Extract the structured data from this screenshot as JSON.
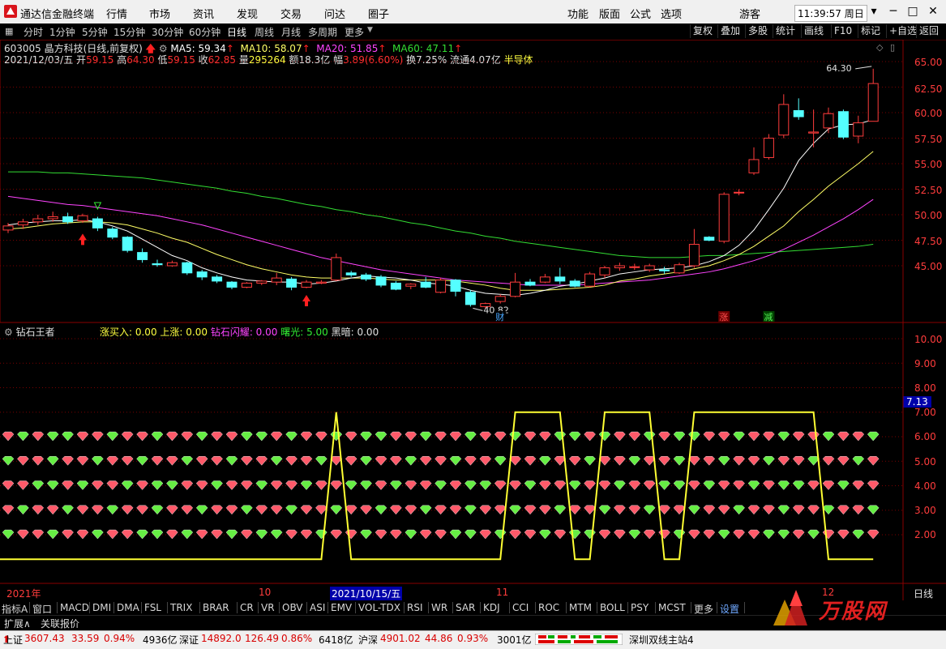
{
  "app": {
    "title": "通达信金融终端",
    "menus": [
      "行情",
      "市场",
      "资讯",
      "发现",
      "交易",
      "问达",
      "圈子"
    ],
    "right_menus": [
      "功能",
      "版面",
      "公式",
      "选项"
    ],
    "user": "游客",
    "clock": "11:39:57 周日"
  },
  "toolbar": {
    "periods": [
      "分时",
      "1分钟",
      "5分钟",
      "15分钟",
      "30分钟",
      "60分钟",
      "日线",
      "周线",
      "月线",
      "多周期",
      "更多"
    ],
    "active_period": "日线",
    "right_buttons": [
      "复权",
      "叠加",
      "多股",
      "统计",
      "画线",
      "F10",
      "标记",
      "+自选",
      "返回"
    ]
  },
  "stock": {
    "code_name": "603005 晶方科技(日线,前复权)",
    "date": "2021/12/03/五",
    "open_label": "开",
    "open": "59.15",
    "high_label": "高",
    "high": "64.30",
    "low_label": "低",
    "low": "59.15",
    "close_label": "收",
    "close": "62.85",
    "volume_label": "量",
    "volume": "295264",
    "amount_label": "额",
    "amount": "18.3亿",
    "change_label": "幅",
    "change": "3.89(6.60%)",
    "turnover": "换7.25%",
    "float_cap": "流通4.07亿",
    "sector": "半导体",
    "high_annotation": "64.30",
    "low_annotation": "40.82",
    "marker_cai": "财",
    "marker_zhang": "涨",
    "marker_jian": "减"
  },
  "ma": {
    "ma5": "MA5: 59.34",
    "ma10": "MA10: 58.07",
    "ma20": "MA20: 51.85",
    "ma60": "MA60: 47.11",
    "colors": {
      "ma5": "#ffffff",
      "ma10": "#ffff66",
      "ma20": "#ff44ff",
      "ma60": "#33dd33"
    }
  },
  "indicator": {
    "name": "钻石王者",
    "zhangmairu": "涨买入: 0.00",
    "shangzhang": "上涨: 0.00",
    "zuanshi": "钻石闪耀: 0.00",
    "shuguang": "曙光: 5.00",
    "heian": "黑暗: 0.00",
    "current_value": "7.13"
  },
  "price_axis": [
    "65.00",
    "62.50",
    "60.00",
    "57.50",
    "55.00",
    "52.50",
    "50.00",
    "47.50",
    "45.00"
  ],
  "ind_axis": [
    "10.00",
    "9.00",
    "8.00",
    "7.00",
    "6.00",
    "5.00",
    "4.00",
    "3.00",
    "2.00"
  ],
  "time_axis": {
    "year": "2021年",
    "oct": "10",
    "cursor_date": "2021/10/15/五",
    "nov": "11",
    "dec": "12",
    "period": "日线"
  },
  "indicator_tabs": [
    "指标A",
    "窗口",
    "MACD",
    "DMI",
    "DMA",
    "FSL",
    "TRIX",
    "BRAR",
    "CR",
    "VR",
    "OBV",
    "ASI",
    "EMV",
    "VOL-TDX",
    "RSI",
    "WR",
    "SAR",
    "KDJ",
    "CCI",
    "ROC",
    "MTM",
    "BOLL",
    "PSY",
    "MCST",
    "更多",
    "设置"
  ],
  "bottom": {
    "expand": "扩展∧",
    "related": "关联报价",
    "watermark": "万股网"
  },
  "status": {
    "sh_label": "上证",
    "sh_index": "3607.43",
    "sh_chg": "33.59",
    "sh_pct": "0.94%",
    "sh_amt": "4936亿",
    "sz_label": "深证",
    "sz_index": "14892.0",
    "sz_chg": "126.49",
    "sz_pct": "0.86%",
    "sz_amt": "6418亿",
    "hs_label": "沪深",
    "hs_index": "4901.02",
    "hs_chg": "44.86",
    "hs_pct": "0.93%",
    "hs_amt": "3001亿",
    "server": "深圳双线主站4"
  },
  "chart_data": {
    "type": "candlestick",
    "price_ylim": [
      43,
      66
    ],
    "candles": [
      [
        48.5,
        49.2,
        48.2,
        48.9
      ],
      [
        49.0,
        49.6,
        48.6,
        49.3
      ],
      [
        49.3,
        50.0,
        49.0,
        49.6
      ],
      [
        49.6,
        50.3,
        49.3,
        49.8
      ],
      [
        49.8,
        50.2,
        49.1,
        49.3
      ],
      [
        49.4,
        50.1,
        49.2,
        49.9
      ],
      [
        49.6,
        49.8,
        48.4,
        48.7
      ],
      [
        48.6,
        48.8,
        47.6,
        47.8
      ],
      [
        47.8,
        47.9,
        46.3,
        46.5
      ],
      [
        46.3,
        46.7,
        45.3,
        45.6
      ],
      [
        45.2,
        45.6,
        44.9,
        45.1
      ],
      [
        45.0,
        45.5,
        44.9,
        45.3
      ],
      [
        45.3,
        45.4,
        44.1,
        44.3
      ],
      [
        44.4,
        44.6,
        43.6,
        43.9
      ],
      [
        43.9,
        44.1,
        43.3,
        43.5
      ],
      [
        43.4,
        43.5,
        42.7,
        42.9
      ],
      [
        42.9,
        43.4,
        42.8,
        43.3
      ],
      [
        43.3,
        43.6,
        43.1,
        43.5
      ],
      [
        43.4,
        44.3,
        43.1,
        43.8
      ],
      [
        43.7,
        43.9,
        42.6,
        42.9
      ],
      [
        42.9,
        43.6,
        42.8,
        43.4
      ],
      [
        43.3,
        43.6,
        43.2,
        43.4
      ],
      [
        43.6,
        46.2,
        43.5,
        45.8
      ],
      [
        44.3,
        44.5,
        43.9,
        44.1
      ],
      [
        44.1,
        44.3,
        43.5,
        43.7
      ],
      [
        43.9,
        44.1,
        42.9,
        43.1
      ],
      [
        43.3,
        43.5,
        42.6,
        42.7
      ],
      [
        43.0,
        43.3,
        42.7,
        43.2
      ],
      [
        43.4,
        43.9,
        42.8,
        42.9
      ],
      [
        42.4,
        43.8,
        42.3,
        43.6
      ],
      [
        43.6,
        43.7,
        42.0,
        42.5
      ],
      [
        42.4,
        42.6,
        41.0,
        41.2
      ],
      [
        41.0,
        41.4,
        40.8,
        41.3
      ],
      [
        41.5,
        42.2,
        41.3,
        42.0
      ],
      [
        42.0,
        44.3,
        41.9,
        43.4
      ],
      [
        43.4,
        43.7,
        43.0,
        43.1
      ],
      [
        43.4,
        44.2,
        43.3,
        43.9
      ],
      [
        43.9,
        44.8,
        43.2,
        43.5
      ],
      [
        43.5,
        43.7,
        42.9,
        43.0
      ],
      [
        43.0,
        44.4,
        42.9,
        44.2
      ],
      [
        44.1,
        45.0,
        43.8,
        44.8
      ],
      [
        44.8,
        45.3,
        44.5,
        45.0
      ],
      [
        44.9,
        45.2,
        44.6,
        44.9
      ],
      [
        44.6,
        45.2,
        44.4,
        45.0
      ],
      [
        44.6,
        44.9,
        44.2,
        44.5
      ],
      [
        44.3,
        45.3,
        44.2,
        45.1
      ],
      [
        45.0,
        48.6,
        44.8,
        47.1
      ],
      [
        47.8,
        47.9,
        47.4,
        47.5
      ],
      [
        47.4,
        52.2,
        47.2,
        52.0
      ],
      [
        52.2,
        52.5,
        51.9,
        52.2
      ],
      [
        54.1,
        56.6,
        53.9,
        55.4
      ],
      [
        55.6,
        57.9,
        55.4,
        57.5
      ],
      [
        57.8,
        61.8,
        57.5,
        60.8
      ],
      [
        60.2,
        61.4,
        59.3,
        59.6
      ],
      [
        58.0,
        60.3,
        56.6,
        58.1
      ],
      [
        58.5,
        60.5,
        58.0,
        59.9
      ],
      [
        60.1,
        60.3,
        57.4,
        57.6
      ],
      [
        57.7,
        59.7,
        57.0,
        59.0
      ],
      [
        59.15,
        64.3,
        59.15,
        62.85
      ]
    ],
    "ma5": [
      49.0,
      49.2,
      49.3,
      49.4,
      49.4,
      49.5,
      49.3,
      48.9,
      48.4,
      47.6,
      46.8,
      46.0,
      45.5,
      44.8,
      44.3,
      43.9,
      43.6,
      43.5,
      43.4,
      43.4,
      43.2,
      43.3,
      43.5,
      43.8,
      44.0,
      43.9,
      43.8,
      43.6,
      43.3,
      43.2,
      43.0,
      42.6,
      42.3,
      42.2,
      42.1,
      42.3,
      42.6,
      43.0,
      43.2,
      43.5,
      43.8,
      44.2,
      44.4,
      44.6,
      44.7,
      44.8,
      45.0,
      45.4,
      46.0,
      47.0,
      48.5,
      50.5,
      52.6,
      55.3,
      57.0,
      58.4,
      58.8,
      58.9,
      59.3
    ],
    "ma10": [
      48.6,
      48.7,
      48.9,
      49.1,
      49.2,
      49.3,
      49.3,
      49.2,
      49.0,
      48.6,
      48.2,
      47.7,
      47.3,
      46.7,
      46.1,
      45.6,
      45.1,
      44.7,
      44.4,
      44.1,
      43.9,
      43.8,
      43.8,
      43.8,
      43.8,
      43.7,
      43.6,
      43.6,
      43.6,
      43.6,
      43.5,
      43.3,
      43.1,
      42.8,
      42.6,
      42.6,
      42.6,
      42.7,
      42.8,
      42.9,
      43.1,
      43.5,
      43.7,
      44.0,
      44.2,
      44.4,
      44.7,
      45.0,
      45.5,
      46.1,
      46.9,
      47.9,
      48.9,
      50.3,
      51.5,
      52.8,
      53.9,
      55.0,
      56.2
    ],
    "ma20": [
      51.8,
      51.6,
      51.4,
      51.2,
      51.0,
      50.9,
      50.7,
      50.5,
      50.3,
      50.1,
      49.9,
      49.6,
      49.3,
      49.0,
      48.6,
      48.2,
      47.8,
      47.4,
      47.0,
      46.6,
      46.2,
      45.8,
      45.5,
      45.2,
      44.9,
      44.6,
      44.4,
      44.2,
      44.0,
      43.8,
      43.6,
      43.5,
      43.4,
      43.3,
      43.2,
      43.1,
      43.1,
      43.1,
      43.1,
      43.2,
      43.3,
      43.4,
      43.5,
      43.6,
      43.8,
      44.0,
      44.2,
      44.4,
      44.7,
      45.1,
      45.5,
      46.0,
      46.6,
      47.3,
      48.0,
      48.8,
      49.6,
      50.5,
      51.5
    ],
    "ma60": [
      54.2,
      54.2,
      54.2,
      54.1,
      54.1,
      54.0,
      53.9,
      53.8,
      53.7,
      53.6,
      53.4,
      53.2,
      53.0,
      52.8,
      52.6,
      52.3,
      52.1,
      51.8,
      51.6,
      51.3,
      51.0,
      50.8,
      50.5,
      50.3,
      50.0,
      49.8,
      49.5,
      49.2,
      49.0,
      48.7,
      48.4,
      48.2,
      47.9,
      47.7,
      47.4,
      47.2,
      47.0,
      46.8,
      46.6,
      46.4,
      46.2,
      46.0,
      45.9,
      45.8,
      45.8,
      45.8,
      45.9,
      46.0,
      46.0,
      46.1,
      46.2,
      46.3,
      46.4,
      46.5,
      46.6,
      46.7,
      46.8,
      46.9,
      47.1
    ],
    "indicator_ylim": [
      1.0,
      10.5
    ],
    "indicator_line": [
      1.0,
      1.0,
      1.0,
      1.0,
      1.0,
      1.0,
      1.0,
      1.0,
      1.0,
      1.0,
      1.0,
      1.0,
      1.0,
      1.0,
      1.0,
      1.0,
      1.0,
      1.0,
      1.0,
      1.0,
      1.0,
      1.0,
      7.0,
      1.0,
      1.0,
      1.0,
      1.0,
      1.0,
      1.0,
      1.0,
      1.0,
      1.0,
      1.0,
      1.0,
      7.0,
      7.0,
      7.0,
      7.0,
      1.0,
      1.0,
      7.0,
      7.0,
      7.0,
      7.0,
      1.0,
      1.0,
      7.0,
      7.0,
      7.0,
      7.0,
      7.0,
      7.0,
      7.0,
      7.0,
      7.0,
      1.0,
      1.0,
      1.0,
      1.0
    ],
    "diamond_rows": [
      6.0,
      5.0,
      4.0,
      3.0,
      2.0
    ],
    "diamond_colors": {
      "green": "#66ee44",
      "red": "#ff5a6a"
    }
  }
}
